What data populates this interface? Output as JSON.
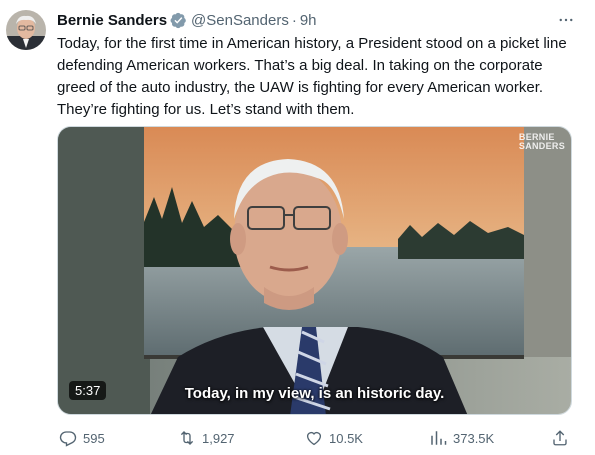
{
  "author": {
    "name": "Bernie Sanders",
    "handle": "@SenSanders",
    "separator": "·",
    "time": "9h",
    "verified": true
  },
  "tweet": {
    "text": "Today, for the first time in American history, a President stood on a picket line defending American workers. That’s a big deal. In taking on the corporate greed of the auto industry, the UAW is fighting for every American worker. They’re fighting for us. Let’s stand with them."
  },
  "video": {
    "duration": "5:37",
    "caption": "Today, in my view, is an historic day.",
    "watermark_line1": "BERNIE",
    "watermark_line2": "SANDERS"
  },
  "actions": {
    "replies": "595",
    "retweets": "1,927",
    "likes": "10.5K",
    "views": "373.5K"
  },
  "icons": {
    "verified": "verified-badge-icon",
    "more": "more-options-icon",
    "reply": "reply-icon",
    "retweet": "retweet-icon",
    "like": "heart-icon",
    "views": "views-chart-icon",
    "share": "share-icon"
  },
  "colors": {
    "text": "#0f1419",
    "secondary": "#536471",
    "verified": "#829aab",
    "border": "#cfd9de"
  }
}
